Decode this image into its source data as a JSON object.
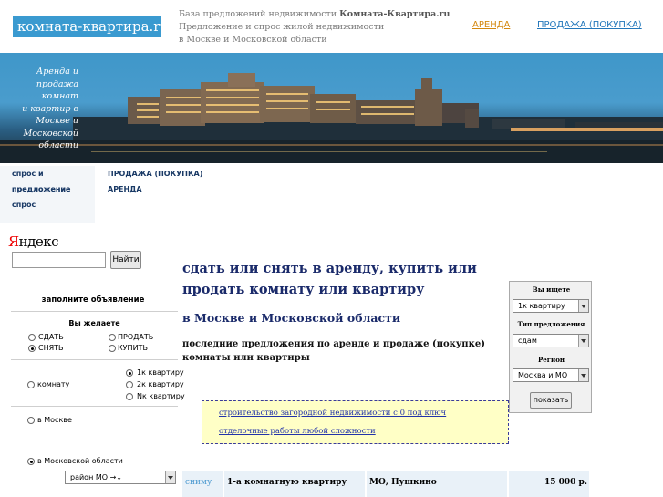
{
  "header": {
    "logo": "комната-квартира.ru",
    "desc_line1_prefix": "База предложений недвижимости ",
    "desc_line1_bold": "Комната-Квартира.ru",
    "desc_line2": "Предложение и спрос жилой недвижимости",
    "desc_line3": "в Москве и Московской области",
    "nav": [
      {
        "label": "АРЕНДА",
        "active": true
      },
      {
        "label": "ПРОДАЖА (ПОКУПКА)",
        "active": false
      }
    ]
  },
  "banner": {
    "lines": [
      "Аренда и",
      "продажа комнат",
      "и квартир в",
      "Москве и",
      "Московской",
      "области"
    ]
  },
  "side_menu": [
    "спрос и предложение",
    "предложение",
    "спрос"
  ],
  "mid_menu": [
    "ПРОДАЖА (ПОКУПКА)",
    "АРЕНДА"
  ],
  "search": {
    "logo_first": "Я",
    "logo_rest": "ндекс",
    "button": "Найти",
    "value": ""
  },
  "form": {
    "title": "заполните объявление",
    "want_label": "Вы желаете",
    "actions": [
      {
        "label": "СДАТЬ",
        "checked": false
      },
      {
        "label": "ПРОДАТЬ",
        "checked": false
      },
      {
        "label": "СНЯТЬ",
        "checked": true
      },
      {
        "label": "КУПИТЬ",
        "checked": false
      }
    ],
    "type_room": "комнату",
    "apartments": [
      {
        "label": "1к квартиру",
        "checked": true
      },
      {
        "label": "2к квартиру",
        "checked": false
      },
      {
        "label": "Nк квартиру",
        "checked": false
      }
    ],
    "loc_moscow": "в Москве",
    "loc_region": "в Московской области",
    "district_select": "район МО →↓"
  },
  "main": {
    "h1": "сдать или снять в аренду, купить или продать комнату или квартиру",
    "h2": "в Москве и Московской области",
    "desc": "последние предложения по аренде и продаже (покупке) комнаты или квартиры",
    "ad_links": [
      "строительство загородной недвижимости с 0 под ключ",
      "отделочные работы любой сложности"
    ]
  },
  "filter": {
    "search_label": "Вы ищете",
    "search_value": "1к квартиру",
    "offer_label": "Тип предложения",
    "offer_value": "сдам",
    "region_label": "Регион",
    "region_value": "Москва и МО",
    "submit": "показать"
  },
  "results": [
    {
      "action": "сниму",
      "type": "1-а комнатную квартиру",
      "location": "МО, Пушкино",
      "price": "15 000 р."
    }
  ],
  "colors": {
    "logo_bg": "#3a9ad0",
    "nav_active": "#d4880f",
    "nav_link": "#2277bb",
    "heading": "#1a2a6a",
    "ad_bg": "#ffffc6"
  }
}
